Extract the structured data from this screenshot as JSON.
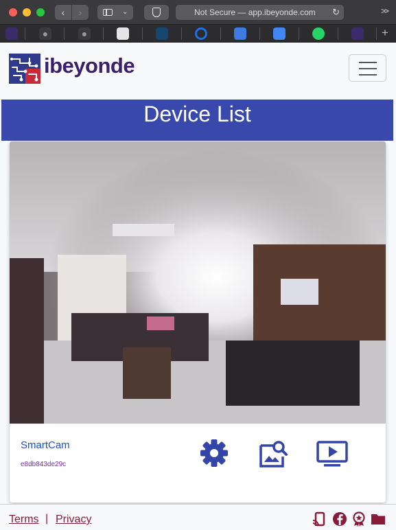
{
  "browser": {
    "url_text": "Not Secure — app.ibeyonde.com",
    "overflow_glyph": ">>",
    "add_tab_glyph": "+"
  },
  "header": {
    "brand": "ibeyonde",
    "menu_icon": "hamburger-icon"
  },
  "page": {
    "title": "Device List"
  },
  "devices": [
    {
      "name": "SmartCam",
      "id": "e8db843de29c",
      "actions": [
        "settings-icon",
        "image-search-icon",
        "live-view-icon"
      ]
    }
  ],
  "footer": {
    "terms": "Terms",
    "separator": "|",
    "privacy": "Privacy",
    "icons": [
      "cast-icon",
      "facebook-icon",
      "award-icon",
      "folder-icon"
    ]
  },
  "colors": {
    "brand_purple": "#3b1f6b",
    "title_band": "#3949ab",
    "action_blue": "#3345a6",
    "footer_link": "#8a1a3a"
  }
}
